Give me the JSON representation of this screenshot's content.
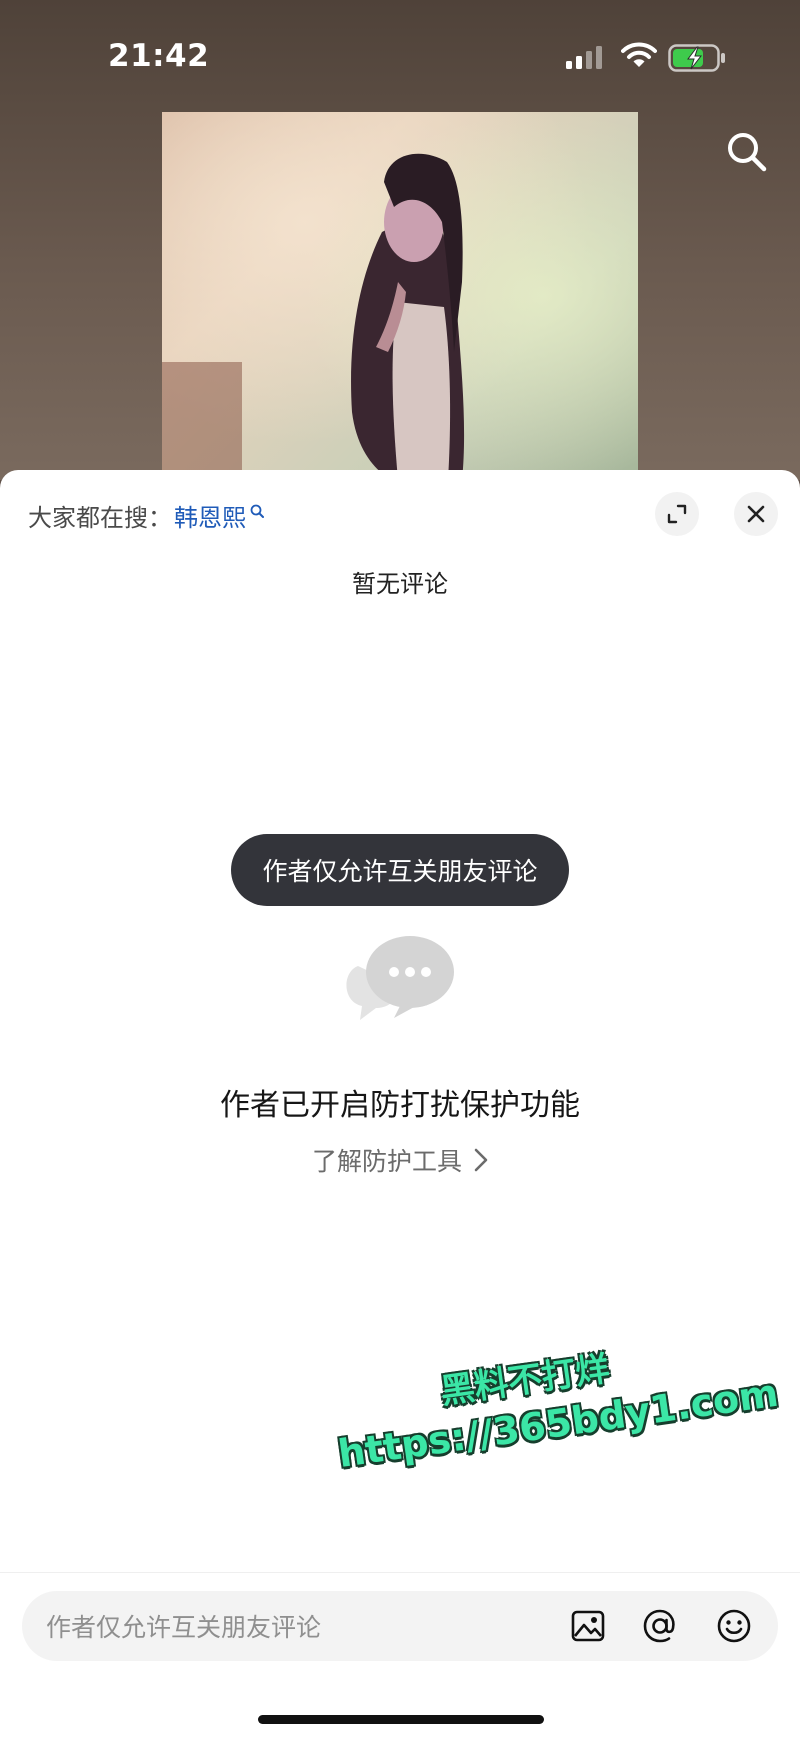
{
  "status_bar": {
    "time": "21:42"
  },
  "header": {
    "search_icon": "search-icon"
  },
  "comment_sheet": {
    "hot_search_prefix": "大家都在搜：",
    "hot_search_keyword": "韩恩熙",
    "empty_title": "暂无评论",
    "toast": "作者仅允许互关朋友评论",
    "protection_title": "作者已开启防打扰保护功能",
    "protection_link": "了解防护工具"
  },
  "watermark": {
    "line1": "黑料不打烊",
    "line2": "https://365bdy1.com"
  },
  "input_bar": {
    "placeholder": "作者仅允许互关朋友评论",
    "icons": [
      "image-icon",
      "at-icon",
      "emoji-icon"
    ]
  },
  "colors": {
    "keyword_blue": "#1f5bb8",
    "toast_bg": "#33343a",
    "battery_green": "#3ecb4c",
    "watermark_green": "#3be6a6"
  }
}
